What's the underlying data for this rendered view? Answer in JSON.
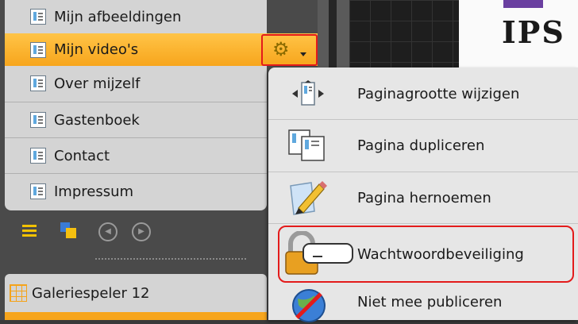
{
  "pages": {
    "items": [
      {
        "label": "Mijn afbeeldingen"
      },
      {
        "label": "Mijn video's",
        "selected": true
      },
      {
        "label": "Over mijzelf"
      },
      {
        "label": "Gastenboek"
      },
      {
        "label": "Contact"
      },
      {
        "label": "Impressum"
      }
    ]
  },
  "toolbar": {
    "icons": [
      "list-icon",
      "squares-icon",
      "prev-icon",
      "next-icon"
    ],
    "prev_glyph": "◀",
    "next_glyph": "▶"
  },
  "gallery": {
    "label": "Galeriespeler 12"
  },
  "canvas": {
    "logo_text": "IPS"
  },
  "context_menu": {
    "items": [
      {
        "label": "Paginagrootte wijzigen",
        "icon": "resize-page-icon"
      },
      {
        "label": "Pagina dupliceren",
        "icon": "duplicate-page-icon"
      },
      {
        "label": "Pagina hernoemen",
        "icon": "rename-page-icon"
      },
      {
        "label": "Wachtwoordbeveiliging",
        "icon": "password-lock-icon",
        "highlighted": true
      },
      {
        "label": "Niet mee publiceren",
        "icon": "no-publish-icon"
      }
    ]
  },
  "colors": {
    "selected_row": "#f7a51c",
    "highlight_border": "#e31b1b",
    "menu_bg": "#e6e6e6"
  }
}
